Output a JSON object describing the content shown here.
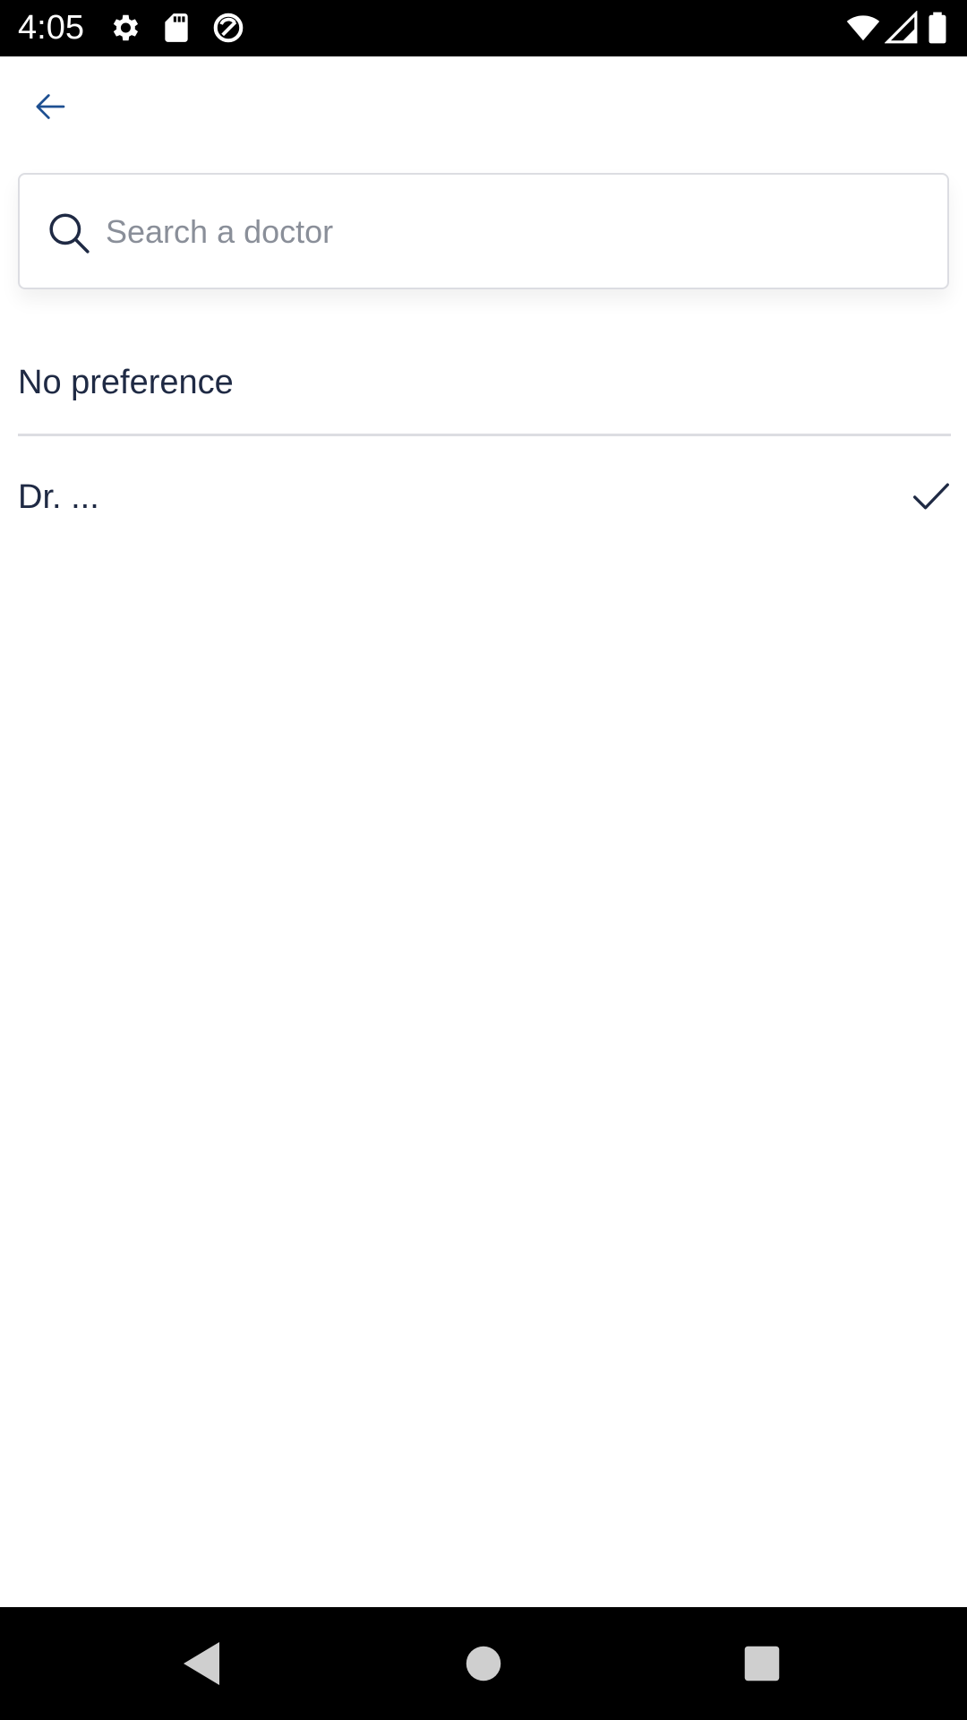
{
  "status_bar": {
    "time": "4:05",
    "left_icons": [
      "gear-icon",
      "sd-card-icon",
      "sync-icon"
    ],
    "right_icons": [
      "wifi-icon",
      "signal-icon",
      "battery-icon"
    ]
  },
  "header": {
    "back_icon": "arrow-left-icon",
    "accent_color": "#1d4f91"
  },
  "search": {
    "placeholder": "Search a doctor",
    "value": ""
  },
  "options": [
    {
      "label": "No preference",
      "selected": false
    },
    {
      "label": "Dr. ...",
      "selected": true
    }
  ],
  "nav_bar": {
    "buttons": [
      "back-triangle-icon",
      "home-circle-icon",
      "recents-square-icon"
    ]
  }
}
